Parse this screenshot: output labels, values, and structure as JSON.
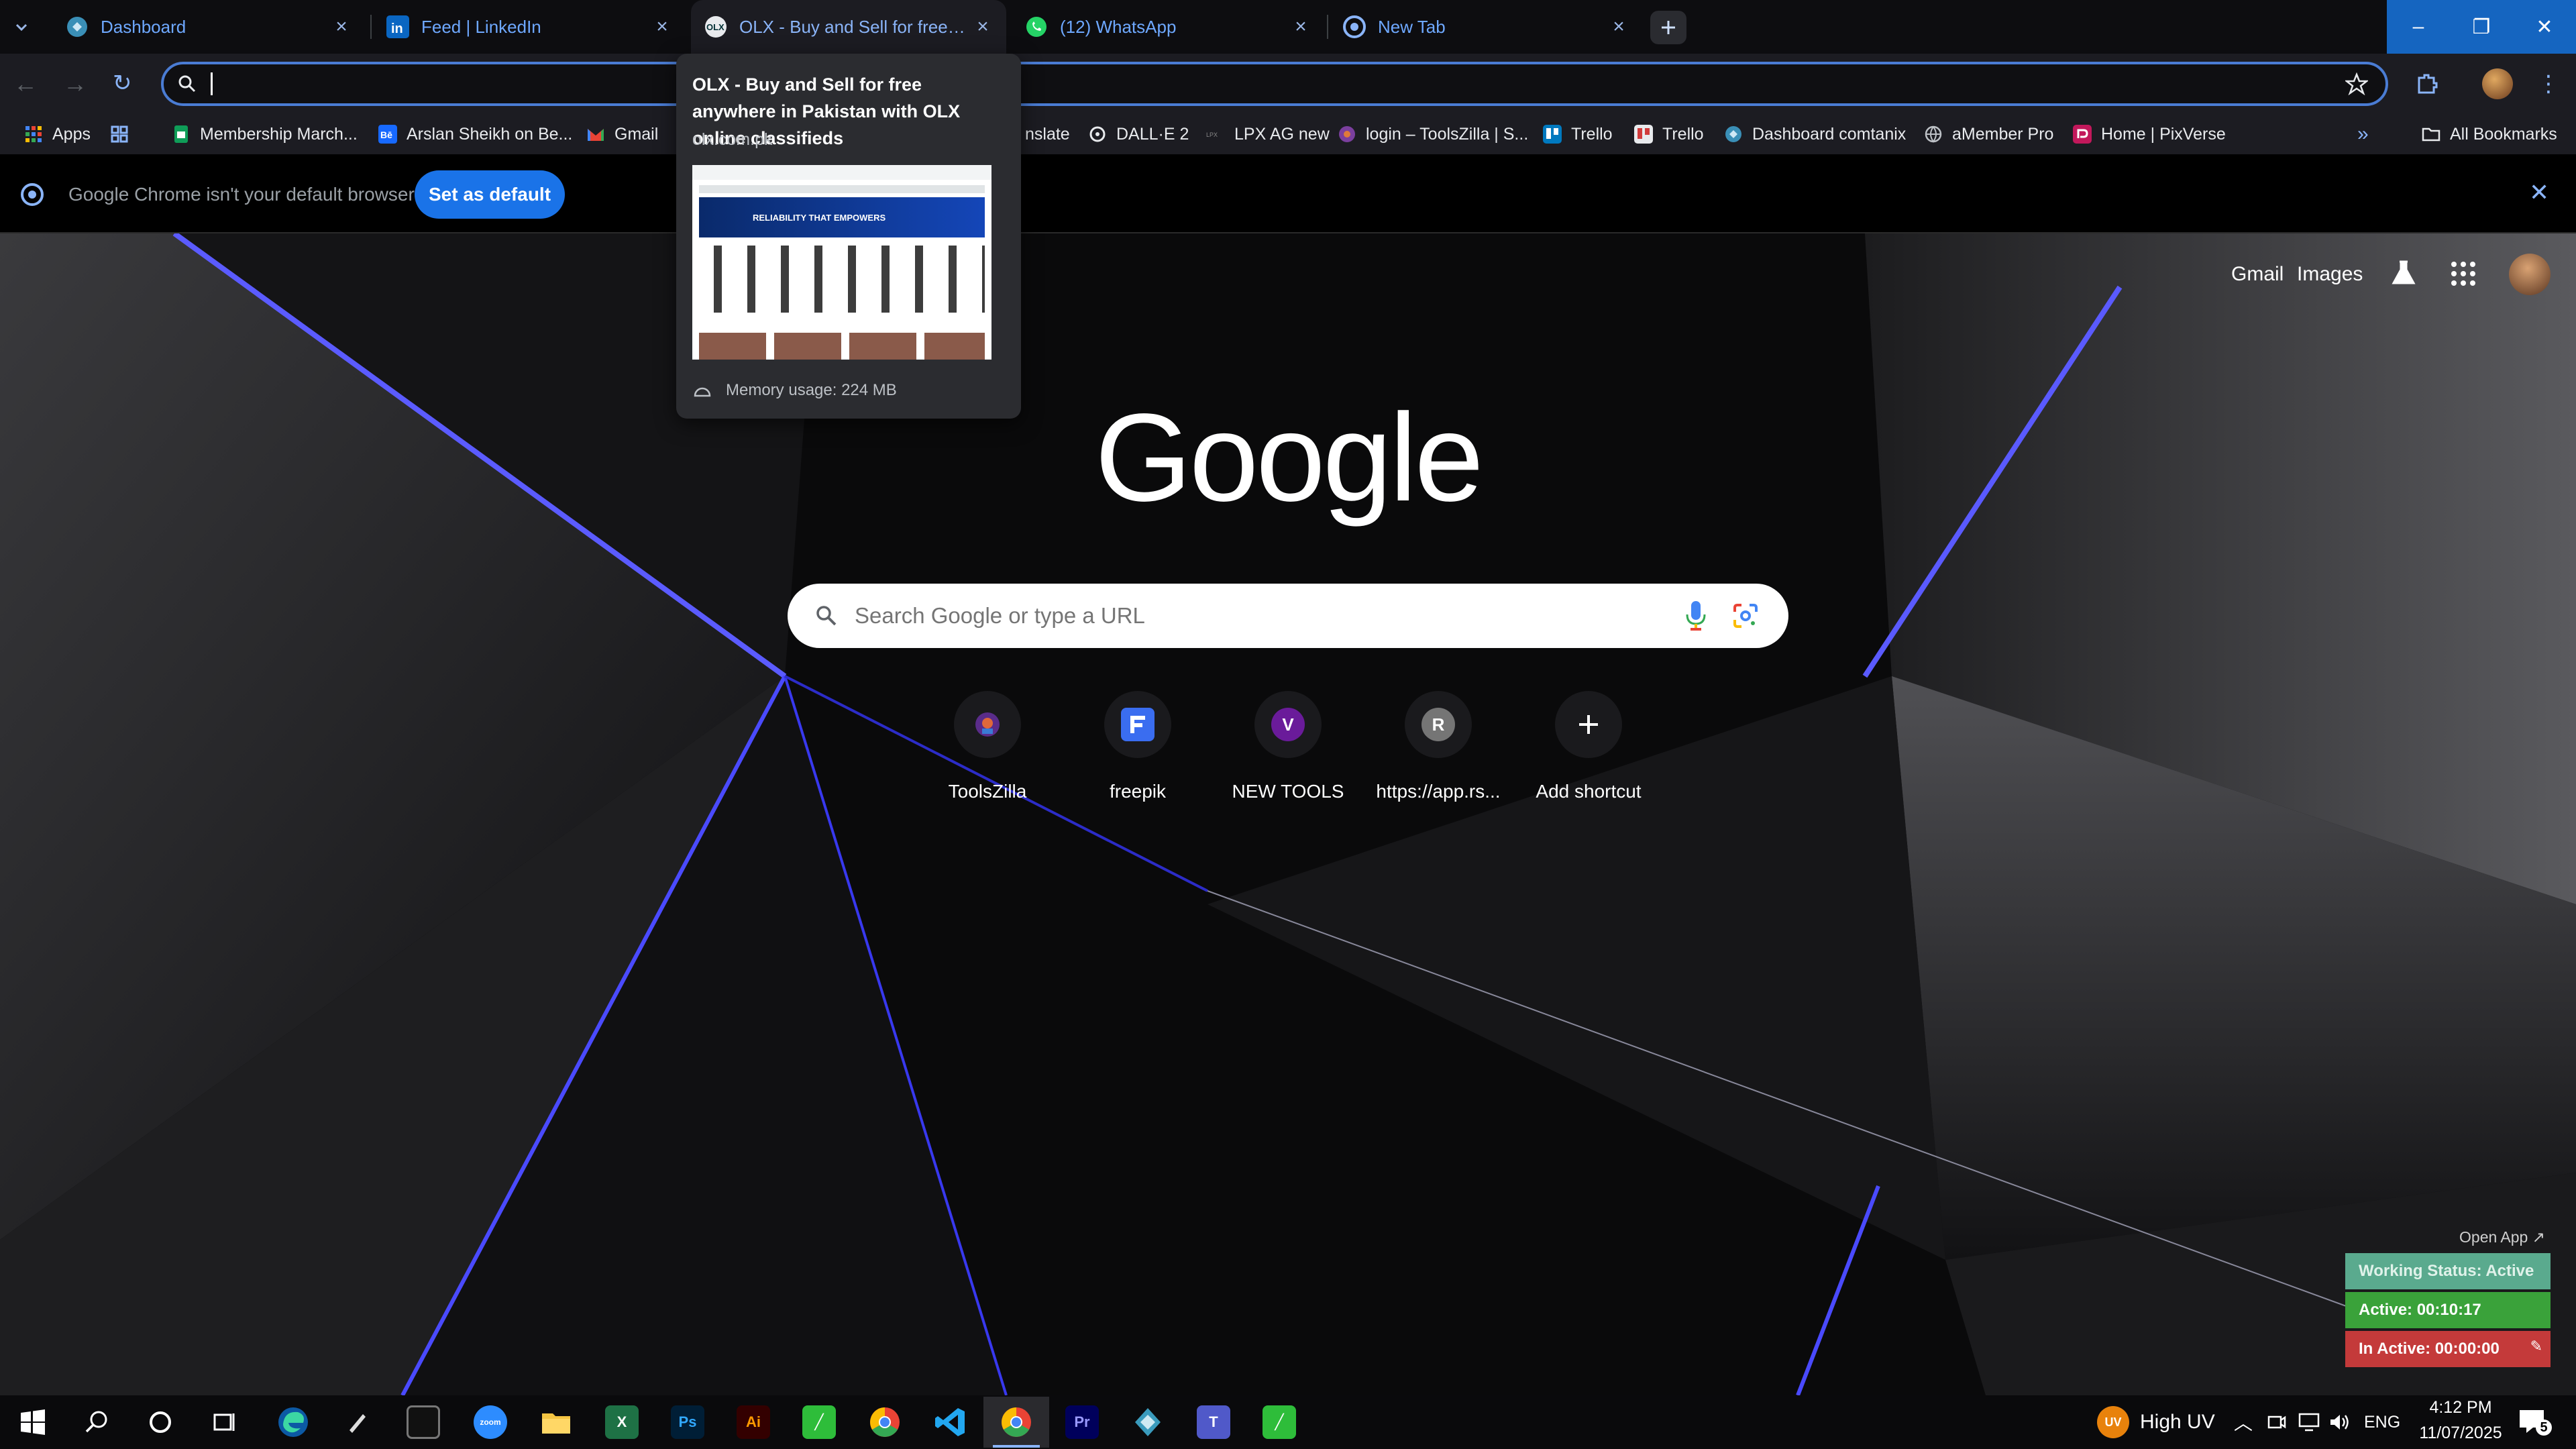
{
  "tabs": [
    {
      "title": "Dashboard"
    },
    {
      "title": "Feed | LinkedIn"
    },
    {
      "title": "OLX - Buy and Sell for free anywhere in Pakistan with OLX online classifieds"
    },
    {
      "title": "(12) WhatsApp"
    },
    {
      "title": "New Tab"
    }
  ],
  "omnibox": {
    "value": "",
    "placeholder": ""
  },
  "bookmarks": [
    {
      "label": "Apps"
    },
    {
      "label": "Membership March..."
    },
    {
      "label": "Arslan Sheikh on Be..."
    },
    {
      "label": "Gmail"
    },
    {
      "label": "nslate"
    },
    {
      "label": "DALL·E 2"
    },
    {
      "label": "LPX AG new"
    },
    {
      "label": "login – ToolsZilla | S..."
    },
    {
      "label": "Trello"
    },
    {
      "label": "Trello"
    },
    {
      "label": "Dashboard comtanix"
    },
    {
      "label": "aMember Pro"
    },
    {
      "label": "Home | PixVerse"
    }
  ],
  "all_bookmarks": "All Bookmarks",
  "infobar": {
    "message": "Google Chrome isn't your default browser",
    "button": "Set as default"
  },
  "tab_hover_card": {
    "title": "OLX - Buy and Sell for free anywhere in Pakistan with OLX online classifieds",
    "domain": "olx.com.pk",
    "memory": "Memory usage: 224 MB",
    "preview_banner": "RELIABILITY THAT EMPOWERS"
  },
  "ntp": {
    "links": {
      "gmail": "Gmail",
      "images": "Images"
    },
    "logo": "Google",
    "search_placeholder": "Search Google or type a URL",
    "shortcuts": [
      {
        "label": "ToolsZilla"
      },
      {
        "label": "freepik"
      },
      {
        "label": "NEW TOOLS",
        "letter": "V"
      },
      {
        "label": "https://app.rs...",
        "letter": "R"
      },
      {
        "label": "Add shortcut"
      }
    ]
  },
  "tracker_widget": {
    "open_app": "Open App ↗",
    "working_status": "Working Status: Active",
    "active": "Active: 00:10:17",
    "inactive": "In Active: 00:00:00"
  },
  "taskbar": {
    "weather": "High UV",
    "weather_badge": "UV",
    "language": "ENG",
    "time": "4:12 PM",
    "date": "11/07/2025",
    "notification_count": "5",
    "apps": [
      "start-icon",
      "search-icon",
      "cortana-icon",
      "task-view-icon",
      "edge-icon",
      "pen-icon",
      "terminal-icon",
      "zoom-icon",
      "file-explorer-icon",
      "excel-icon",
      "photoshop-icon",
      "illustrator-icon",
      "app-green-icon",
      "chrome-icon",
      "vscode-icon",
      "chrome-active-icon",
      "premiere-icon",
      "app-teal-icon",
      "teams-icon",
      "app-green2-icon"
    ]
  }
}
